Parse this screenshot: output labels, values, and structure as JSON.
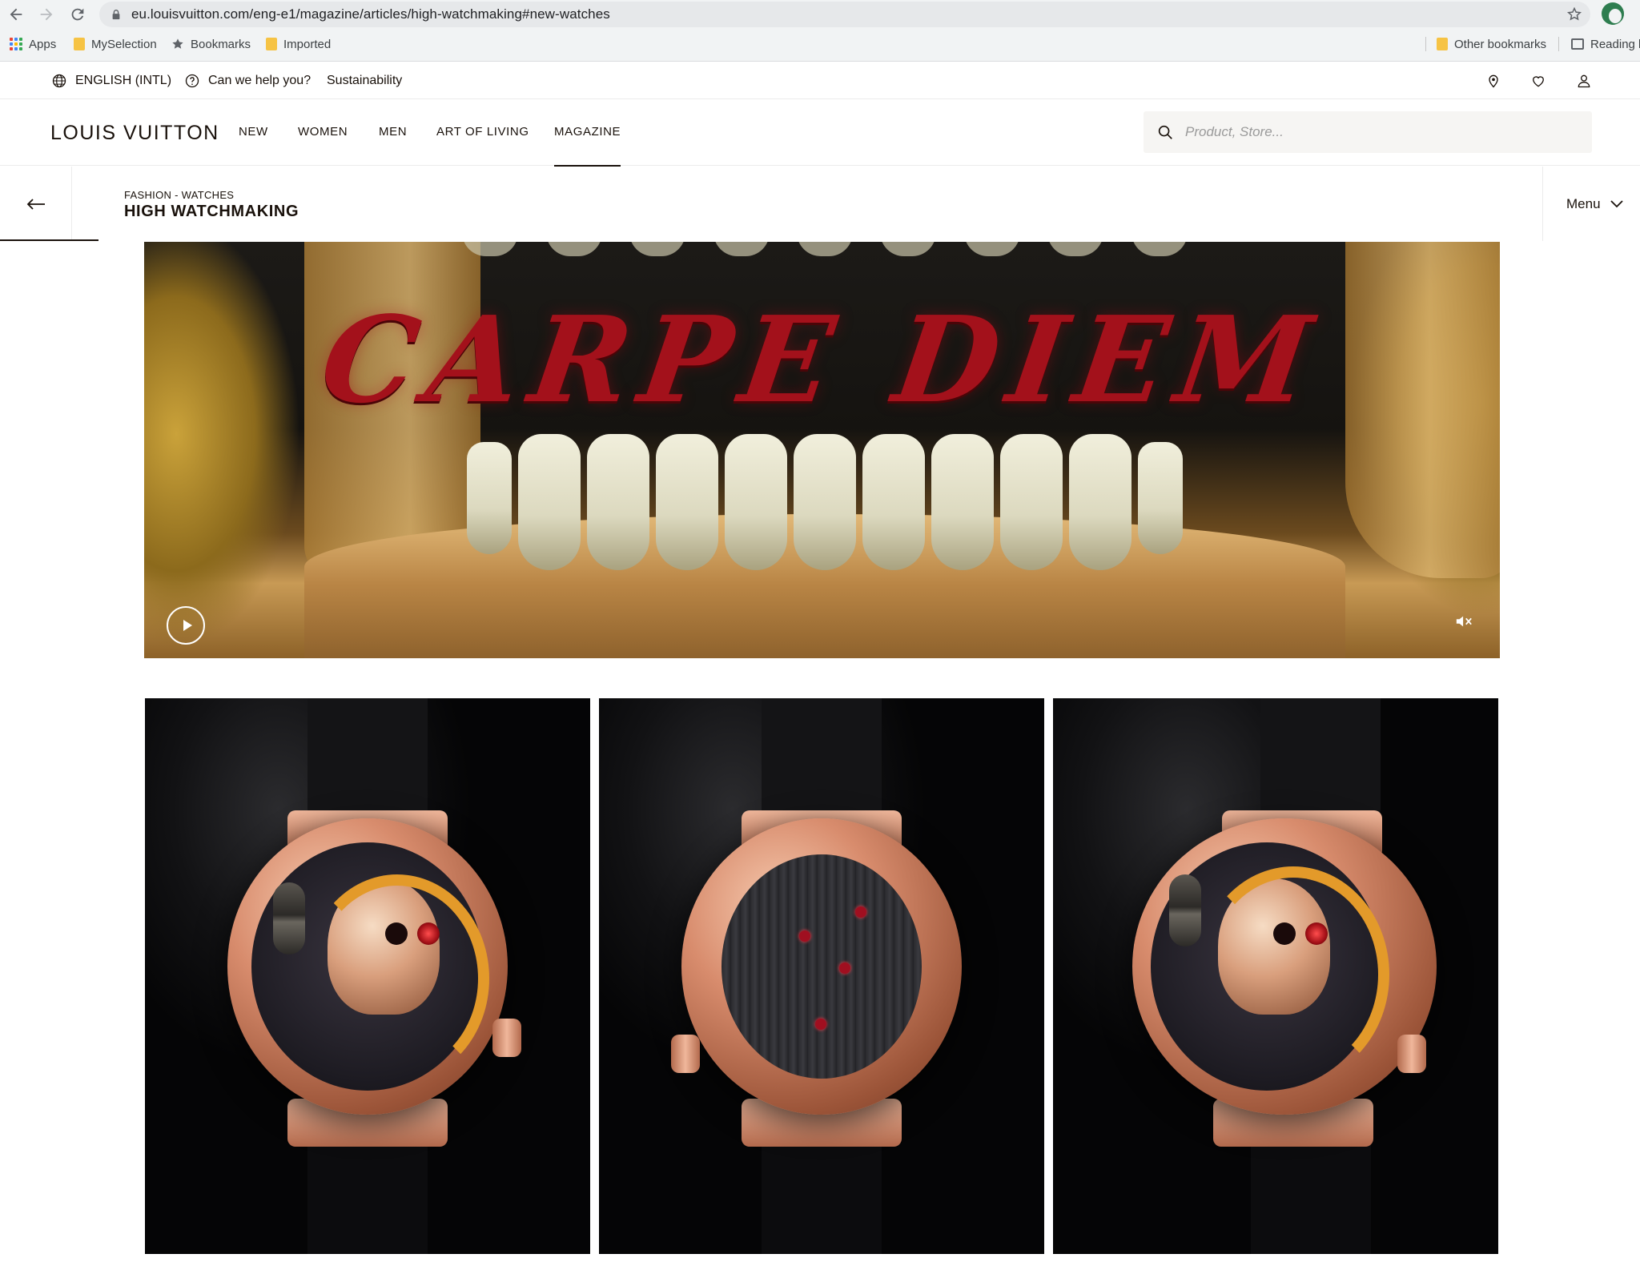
{
  "browser": {
    "url": "eu.louisvuitton.com/eng-e1/magazine/articles/high-watchmaking#new-watches",
    "bookmarks": [
      "Apps",
      "MySelection",
      "Bookmarks",
      "Imported"
    ],
    "other_bookmarks": "Other bookmarks",
    "reading_list": "Reading li"
  },
  "utility": {
    "language": "ENGLISH (INTL)",
    "help": "Can we help you?",
    "sustainability": "Sustainability"
  },
  "header": {
    "logo": "LOUIS VUITTON",
    "nav": [
      "NEW",
      "WOMEN",
      "MEN",
      "ART OF LIVING",
      "MAGAZINE"
    ],
    "active_nav": "MAGAZINE",
    "search_placeholder": "Product, Store..."
  },
  "article": {
    "breadcrumb": "FASHION - WATCHES",
    "title": "HIGH WATCHMAKING",
    "menu_label": "Menu",
    "reading_progress_percent": 6
  },
  "video": {
    "overlay_text": "CARPE DIEM",
    "state": "paused",
    "muted": true
  },
  "gallery": {
    "count": 3
  },
  "colors": {
    "text": "#19110b",
    "search_bg": "#f6f5f3",
    "omnibox_bg": "#e6e8ea",
    "chrome_bg": "#f1f3f4"
  }
}
